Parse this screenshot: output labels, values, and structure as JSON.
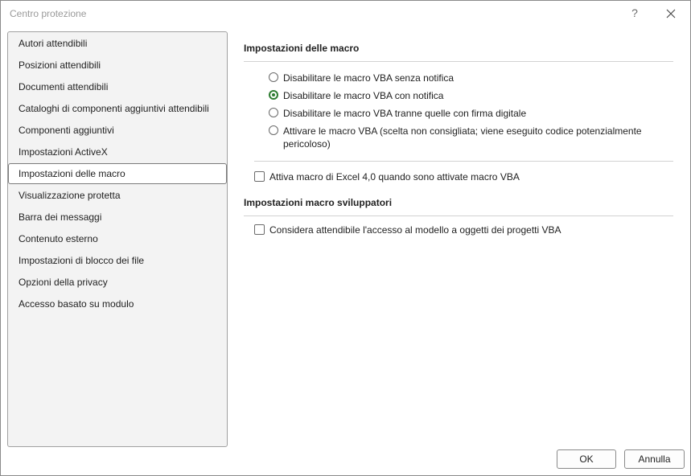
{
  "window": {
    "title": "Centro protezione",
    "help_label": "?"
  },
  "sidebar": {
    "items": [
      {
        "label": "Autori attendibili"
      },
      {
        "label": "Posizioni attendibili"
      },
      {
        "label": "Documenti attendibili"
      },
      {
        "label": "Cataloghi di componenti aggiuntivi attendibili"
      },
      {
        "label": "Componenti aggiuntivi"
      },
      {
        "label": "Impostazioni ActiveX"
      },
      {
        "label": "Impostazioni delle macro",
        "selected": true
      },
      {
        "label": "Visualizzazione protetta"
      },
      {
        "label": "Barra dei messaggi"
      },
      {
        "label": "Contenuto esterno"
      },
      {
        "label": "Impostazioni di blocco dei file"
      },
      {
        "label": "Opzioni della privacy"
      },
      {
        "label": "Accesso basato su modulo"
      }
    ]
  },
  "macro_settings": {
    "header": "Impostazioni delle macro",
    "options": [
      {
        "label": "Disabilitare le macro VBA senza notifica",
        "checked": false
      },
      {
        "label": "Disabilitare le macro VBA con notifica",
        "checked": true
      },
      {
        "label": "Disabilitare le macro VBA tranne quelle con firma digitale",
        "checked": false
      },
      {
        "label": "Attivare le macro VBA (scelta non consigliata; viene eseguito codice potenzialmente pericoloso)",
        "checked": false
      }
    ],
    "excel4_label": "Attiva macro di Excel 4,0 quando sono attivate macro VBA",
    "excel4_checked": false
  },
  "developer_settings": {
    "header": "Impostazioni macro sviluppatori",
    "vba_access_label": "Considera attendibile l'accesso al modello a oggetti dei progetti VBA",
    "vba_access_checked": false
  },
  "footer": {
    "ok_label": "OK",
    "cancel_label": "Annulla"
  },
  "colors": {
    "accent": "#2e7d32",
    "sidebar_bg": "#f3f3f3"
  }
}
